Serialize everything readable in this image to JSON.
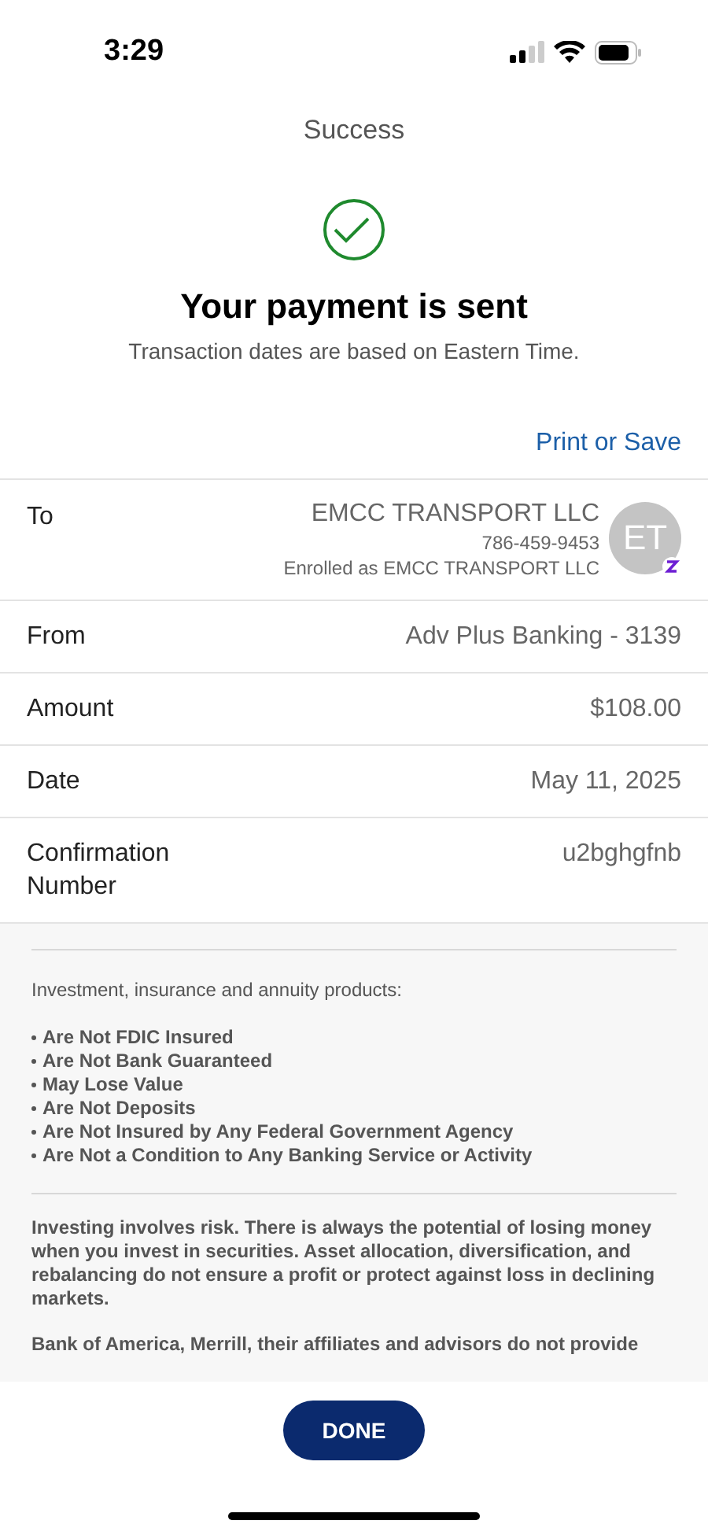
{
  "status_bar": {
    "time": "3:29"
  },
  "header": {
    "title": "Success"
  },
  "confirmation": {
    "heading": "Your payment is sent",
    "subtitle": "Transaction dates are based on Eastern Time."
  },
  "print_link": "Print or Save",
  "recipient": {
    "label": "To",
    "name": "EMCC TRANSPORT LLC",
    "phone": "786-459-9453",
    "enrolled": "Enrolled as EMCC TRANSPORT LLC",
    "initials": "ET"
  },
  "details": [
    {
      "label": "From",
      "value": "Adv Plus Banking - 3139"
    },
    {
      "label": "Amount",
      "value": "$108.00"
    },
    {
      "label": "Date",
      "value": "May 11, 2025"
    },
    {
      "label": "Confirmation Number",
      "value": "u2bghgfnb"
    }
  ],
  "disclosure": {
    "intro": "Investment, insurance and annuity products:",
    "bullets": [
      "Are Not FDIC Insured",
      "Are Not Bank Guaranteed",
      "May Lose Value",
      "Are Not Deposits",
      "Are Not Insured by Any Federal Government Agency",
      "Are Not a Condition to Any Banking Service or Activity"
    ],
    "paragraphs": [
      "Investing involves risk. There is always the potential of losing money when you invest in securities. Asset allocation, diversification, and rebalancing do not ensure a profit or protect against loss in declining markets.",
      "Bank of America, Merrill, their affiliates and advisors do not provide"
    ]
  },
  "done_button": "DONE"
}
